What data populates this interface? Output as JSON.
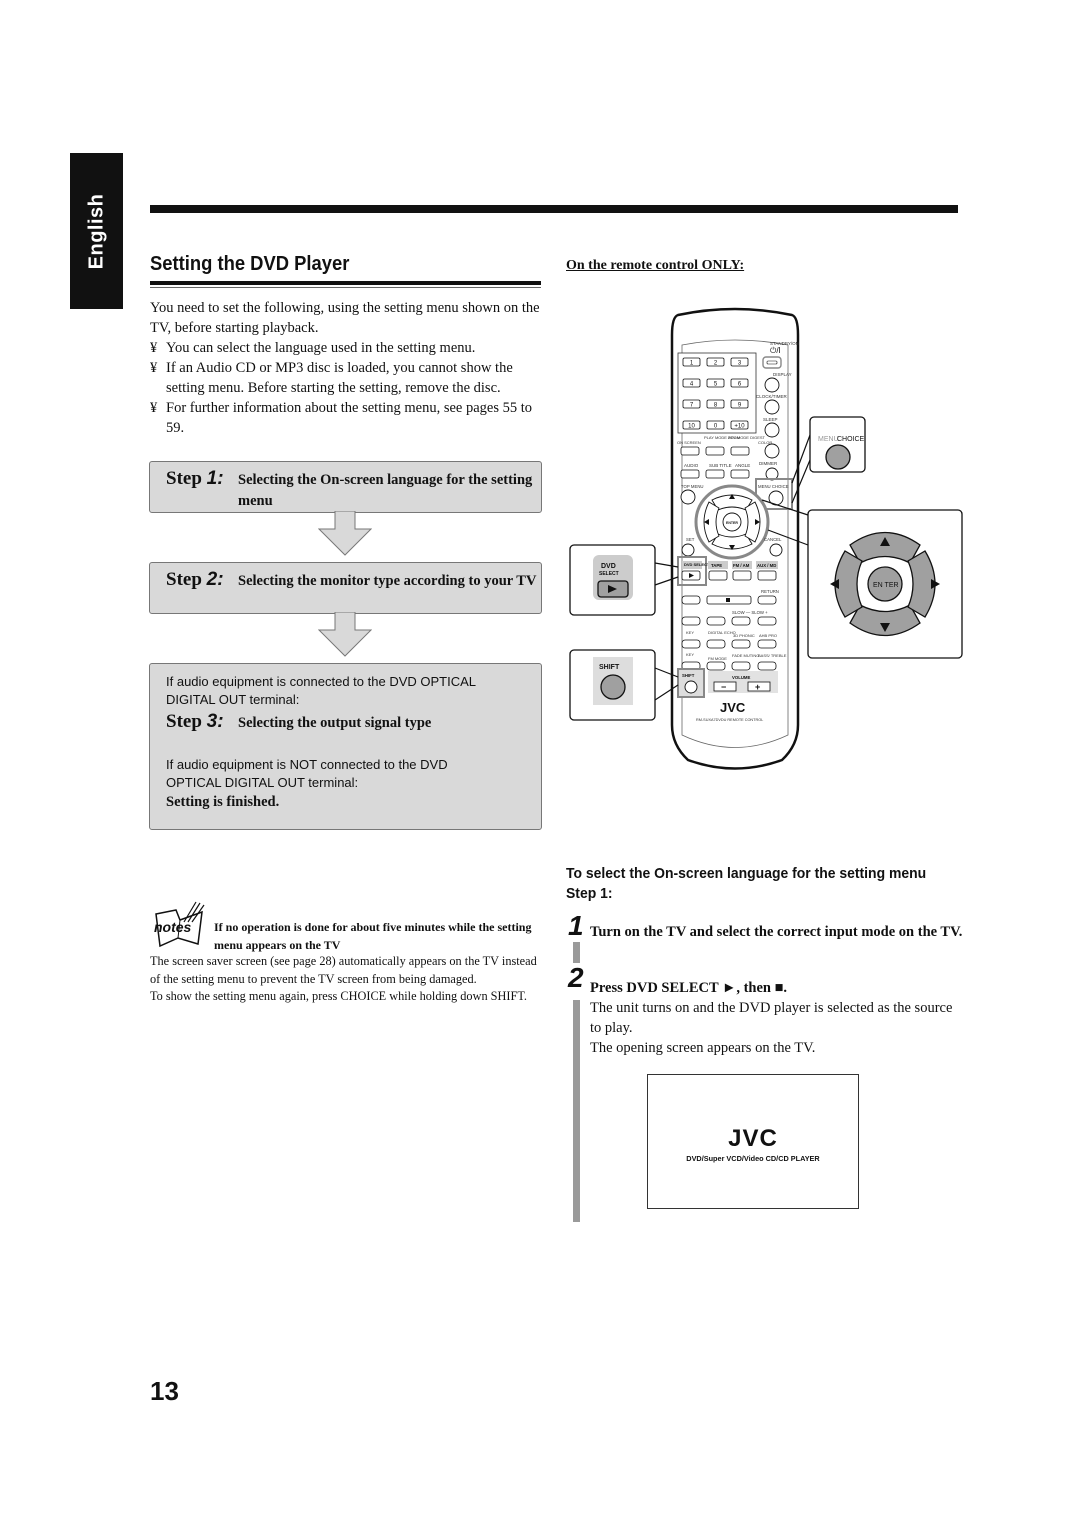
{
  "language_tab": "English",
  "page_title": "Setting the DVD Player",
  "intro": {
    "text": "You need to set the following, using the setting menu shown on the TV, before starting playback.",
    "bullet_mark": "¥",
    "bullets": [
      "You can select the language used in the setting menu.",
      "If an Audio CD or MP3 disc is loaded, you cannot show the setting menu. Before starting the setting, remove the disc.",
      "For further information about the setting menu, see pages 55 to 59."
    ]
  },
  "steps": [
    {
      "word": "Step",
      "num": "1:",
      "desc": "Selecting the On-screen language for the setting menu"
    },
    {
      "word": "Step",
      "num": "2:",
      "desc": "Selecting the monitor type according to your TV"
    },
    {
      "word": "Step",
      "num": "3:",
      "desc": "Selecting the output signal type"
    }
  ],
  "step3_box": {
    "condition_connected": "If audio equipment is connected to the DVD OPTICAL DIGITAL OUT terminal:",
    "condition_not_connected": "If audio equipment is NOT connected to the DVD OPTICAL DIGITAL OUT terminal:",
    "finished": "Setting is finished."
  },
  "notes": {
    "icon_label": "notes",
    "title": "If no operation is done for about five minutes while the setting menu appears on the TV",
    "paragraphs": [
      "The screen saver screen (see page 28) automatically appears on the TV instead of the setting menu to prevent the TV screen from being damaged.",
      "To show the setting menu again, press CHOICE while holding down SHIFT."
    ]
  },
  "remote": {
    "heading": "On the remote control ONLY:",
    "labels": {
      "standby": "STANDBY/ON",
      "power": "⏻/I",
      "display": "DISPLAY",
      "clock": "CLOCK/TIMER",
      "sleep": "SLEEP",
      "on_screen": "ON SCREEN",
      "play_mode": "PLAY MODE ZOOM",
      "rev_mode": "REV.MODE DIGEST",
      "color": "COLOR",
      "dvd_level": "DVD LEVEL",
      "audio": "AUDIO",
      "sub_title": "SUB TITLE",
      "angle": "ANGLE",
      "dimmer": "DIMMER",
      "top_menu": "TOP MENU",
      "menu_choice": "MENU CHOICE",
      "enter": "ENTER",
      "set": "SET",
      "cancel": "CANCEL",
      "dvd_select": "DVD SELECT",
      "tape": "TAPE",
      "fm_am": "FM / AM",
      "aux_md": "AUX / MD",
      "return": "RETURN",
      "slow": "SLOW — SLOW +",
      "key": "KEY",
      "digital_echo": "DIGITAL ECHO",
      "phonic": "3D PHONIC",
      "ahb_pro": "AHB PRO",
      "fm_mode": "FM MODE",
      "fade_muting": "FADE MUTING",
      "bass_treble": "BASS/ TREBLE",
      "shift": "SHIFT",
      "volume": "VOLUME",
      "brand": "JVC",
      "model": "RM-SUXA7DVDU REMOTE CONTROL"
    },
    "keypad": [
      "1",
      "2",
      "3",
      "4",
      "5",
      "6",
      "7",
      "8",
      "9",
      "10",
      "0",
      "+10"
    ],
    "callout_menu": "MENU",
    "callout_choice": "CHOICE",
    "callout_enter": "EN TER",
    "callout_dvd": "DVD",
    "callout_select": "SELECT",
    "callout_shift": "SHIFT"
  },
  "procedure": {
    "heading": "To select the On-screen language for the setting menu    Step 1:",
    "items": [
      {
        "num": "1",
        "text": "Turn on the TV and select the correct input mode on the TV.",
        "detail": []
      },
      {
        "num": "2",
        "text": "Press DVD SELECT ►, then ■.",
        "detail": [
          "The unit turns on and the DVD player is selected as the source to play.",
          "The opening screen appears on the TV."
        ]
      }
    ]
  },
  "tv_screen": {
    "brand": "JVC",
    "caption": "DVD/Super VCD/Video CD/CD PLAYER"
  },
  "page_number": "13"
}
